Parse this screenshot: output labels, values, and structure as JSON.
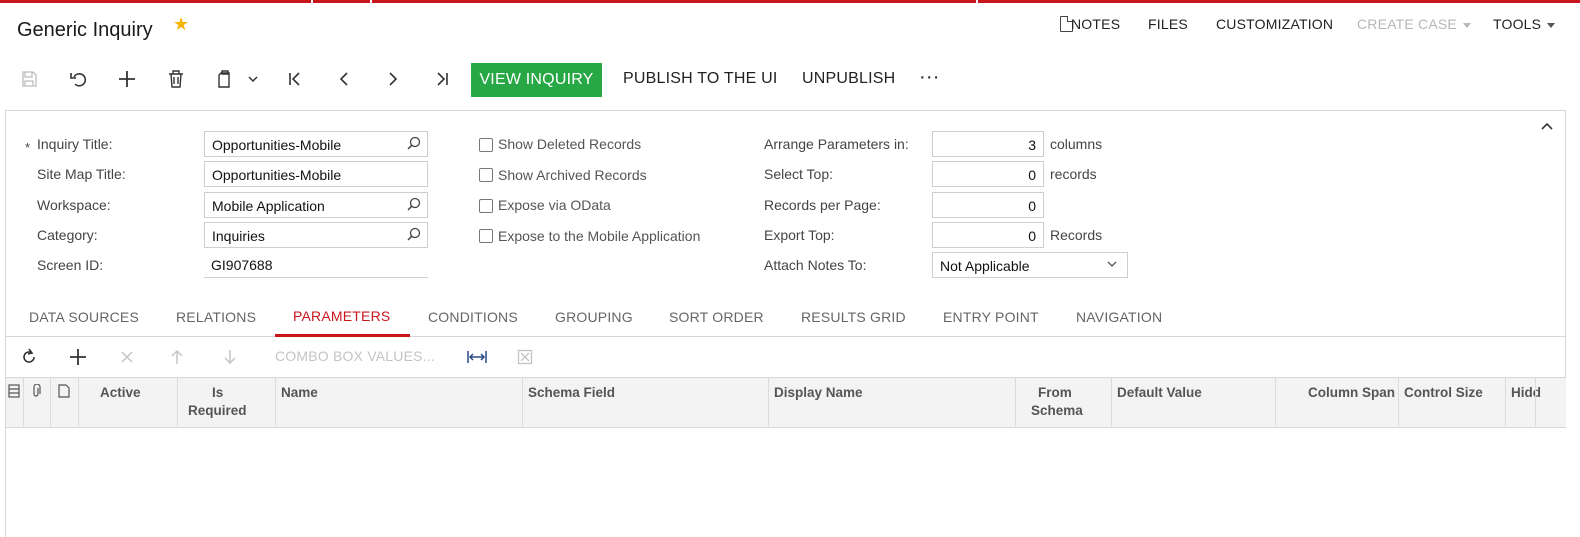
{
  "header": {
    "title": "Generic Inquiry",
    "menu": {
      "notes": "NOTES",
      "files": "FILES",
      "customization": "CUSTOMIZATION",
      "create_case": "CREATE CASE",
      "tools": "TOOLS"
    }
  },
  "toolbar": {
    "view_inquiry": "VIEW INQUIRY",
    "publish": "PUBLISH TO THE UI",
    "unpublish": "UNPUBLISH",
    "more": "···"
  },
  "form": {
    "inquiry_title": {
      "label": "Inquiry Title:",
      "value": "Opportunities-Mobile"
    },
    "site_map_title": {
      "label": "Site Map Title:",
      "value": "Opportunities-Mobile"
    },
    "workspace": {
      "label": "Workspace:",
      "value": "Mobile Application"
    },
    "category": {
      "label": "Category:",
      "value": "Inquiries"
    },
    "screen_id": {
      "label": "Screen ID:",
      "value": "GI907688"
    },
    "checkboxes": {
      "show_deleted": "Show Deleted Records",
      "show_archived": "Show Archived Records",
      "expose_odata": "Expose via OData",
      "expose_mobile": "Expose to the Mobile Application"
    },
    "arrange_params": {
      "label": "Arrange Parameters in:",
      "value": "3",
      "suffix": "columns"
    },
    "select_top": {
      "label": "Select Top:",
      "value": "0",
      "suffix": "records"
    },
    "records_per_page": {
      "label": "Records per Page:",
      "value": "0"
    },
    "export_top": {
      "label": "Export Top:",
      "value": "0",
      "suffix": "Records"
    },
    "attach_notes": {
      "label": "Attach Notes To:",
      "value": "Not Applicable"
    }
  },
  "tabs": [
    "DATA SOURCES",
    "RELATIONS",
    "PARAMETERS",
    "CONDITIONS",
    "GROUPING",
    "SORT ORDER",
    "RESULTS GRID",
    "ENTRY POINT",
    "NAVIGATION"
  ],
  "active_tab": "PARAMETERS",
  "grid_toolbar": {
    "combo_box_values": "COMBO BOX VALUES..."
  },
  "grid": {
    "columns": {
      "active": "Active",
      "is_required_1": "Is",
      "is_required_2": "Required",
      "name": "Name",
      "schema_field": "Schema Field",
      "display_name": "Display Name",
      "from_schema_1": "From",
      "from_schema_2": "Schema",
      "default_value": "Default Value",
      "column_span": "Column Span",
      "control_size": "Control Size",
      "hidden": "Hidd"
    },
    "rows": []
  }
}
